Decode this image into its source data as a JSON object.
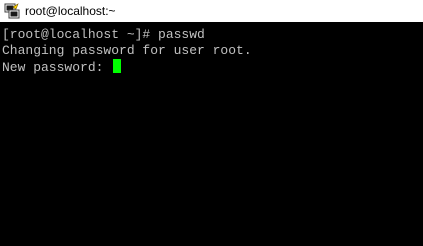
{
  "window": {
    "title": "root@localhost:~",
    "icon": "putty-terminal-icon"
  },
  "terminal": {
    "lines": [
      "[root@localhost ~]# passwd",
      "Changing password for user root.",
      "New password: "
    ],
    "text_color": "#c0c0c0",
    "background_color": "#000000",
    "cursor_color": "#00ff00"
  }
}
